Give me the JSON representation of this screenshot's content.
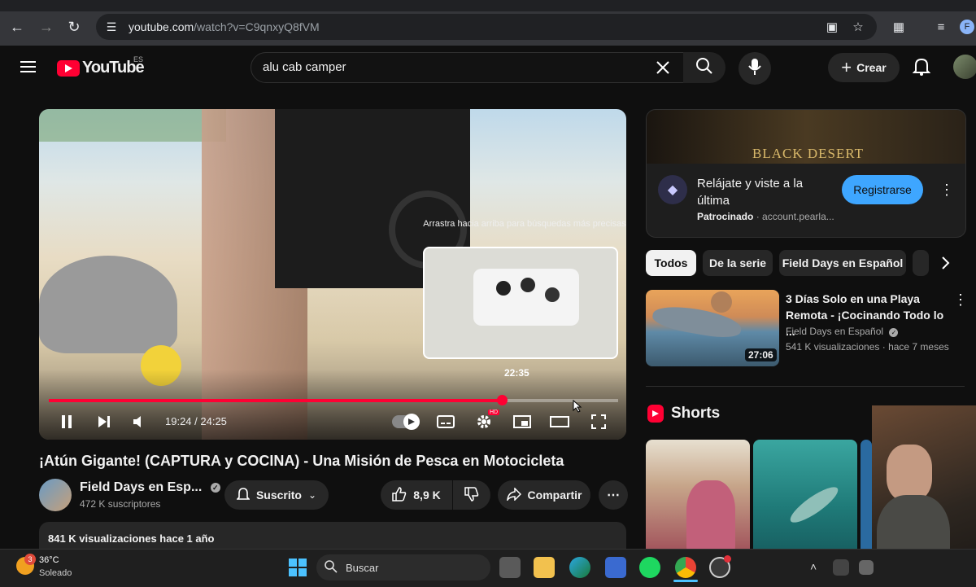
{
  "browser": {
    "url_host": "youtube.com",
    "url_path": "/watch?v=C9qnxyQ8fVM",
    "profile_initial": "F"
  },
  "header": {
    "logo_text": "YouTube",
    "logo_region": "ES",
    "search_value": "alu cab camper",
    "create_label": "Crear"
  },
  "player": {
    "time_display": "19:24 / 24:25",
    "progress": 0.795,
    "hover_preview_time": "22:35",
    "drag_hint": "Arrastra hacia arriba para búsquedas más precisas",
    "hd_badge": "HD"
  },
  "video": {
    "title": "¡Atún Gigante! (CAPTURA y COCINA) - Una Misión de Pesca en Motocicleta",
    "channel_name": "Field Days en Esp...",
    "subscribers": "472 K suscriptores",
    "subscribe_label": "Suscrito",
    "likes": "8,9 K",
    "share_label": "Compartir",
    "views_line": "841 K visualizaciones  hace 1 año"
  },
  "ad": {
    "brand_logo": "BLACK DESERT",
    "title": "Relájate y viste a la última",
    "sponsored_label": "Patrocinado",
    "domain": "· account.pearla...",
    "cta_label": "Registrarse"
  },
  "chips": [
    "Todos",
    "De la serie",
    "Field Days en Español"
  ],
  "recommendation": {
    "title": "3 Días Solo en una Playa Remota - ¡Cocinando Todo lo ...",
    "channel": "Field Days en Español",
    "meta": "541 K visualizaciones · hace 7 meses",
    "duration": "27:06"
  },
  "shorts": {
    "label": "Shorts"
  },
  "taskbar": {
    "weather_temp": "36°C",
    "weather_condition": "Soleado",
    "weather_badge": "3",
    "search_label": "Buscar"
  }
}
